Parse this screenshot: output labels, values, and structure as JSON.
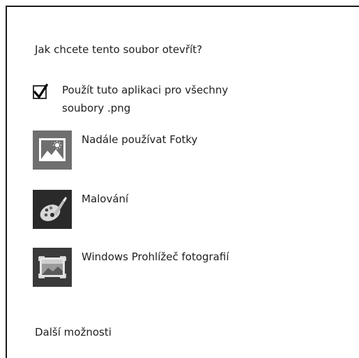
{
  "dialog": {
    "title": "Jak chcete tento soubor otevřít?",
    "checkbox": {
      "label": "Použít tuto aplikaci pro všechny soubory .png",
      "checked": true
    },
    "apps": [
      {
        "label": "Nadále používat Fotky",
        "icon": "photos-icon"
      },
      {
        "label": "Malování",
        "icon": "paint-icon"
      },
      {
        "label": "Windows Prohlížeč fotografií",
        "icon": "photo-viewer-icon"
      }
    ],
    "more_options": "Další možnosti"
  }
}
